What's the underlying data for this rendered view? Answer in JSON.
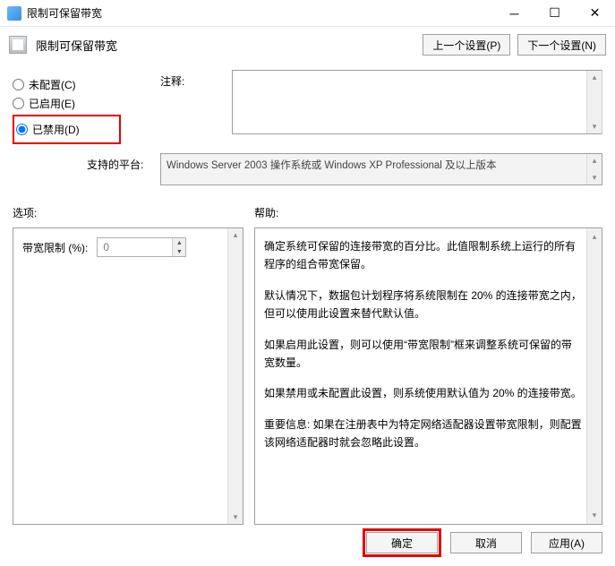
{
  "window": {
    "title": "限制可保留带宽"
  },
  "header": {
    "title": "限制可保留带宽",
    "prev": "上一个设置(P)",
    "next": "下一个设置(N)"
  },
  "radios": {
    "not_configured": "未配置(C)",
    "enabled": "已启用(E)",
    "disabled": "已禁用(D)"
  },
  "labels": {
    "comment": "注释:",
    "platform": "支持的平台:",
    "options": "选项:",
    "help": "帮助:"
  },
  "platform_text": "Windows Server 2003 操作系统或 Windows XP Professional 及以上版本",
  "options_panel": {
    "bandwidth_limit_label": "带宽限制 (%):",
    "bandwidth_limit_value": "0"
  },
  "help": {
    "p1": "确定系统可保留的连接带宽的百分比。此值限制系统上运行的所有程序的组合带宽保留。",
    "p2": "默认情况下，数据包计划程序将系统限制在 20% 的连接带宽之内，但可以使用此设置来替代默认值。",
    "p3": "如果启用此设置，则可以使用“带宽限制”框来调整系统可保留的带宽数量。",
    "p4": "如果禁用或未配置此设置，则系统使用默认值为 20% 的连接带宽。",
    "p5": "重要信息: 如果在注册表中为特定网络适配器设置带宽限制，则配置该网络适配器时就会忽略此设置。"
  },
  "footer": {
    "ok": "确定",
    "cancel": "取消",
    "apply": "应用(A)"
  }
}
